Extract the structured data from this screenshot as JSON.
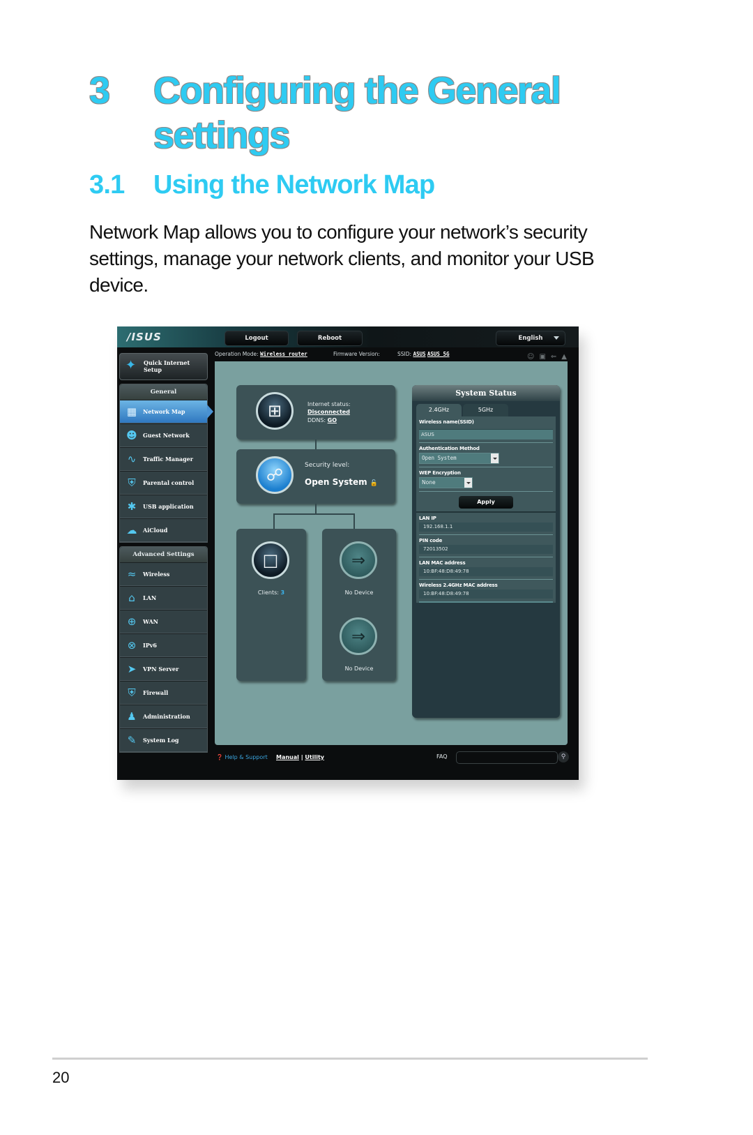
{
  "document": {
    "chapter_number": "3",
    "chapter_title": "Configuring the General settings",
    "section_number": "3.1",
    "section_title": "Using the Network Map",
    "paragraph": "Network Map allows you to configure your network’s security settings, manage your network clients, and monitor your USB device.",
    "page_number": "20"
  },
  "router_ui": {
    "logo": "/ISUS",
    "top_buttons": {
      "logout": "Logout",
      "reboot": "Reboot",
      "language": "English"
    },
    "op_bar": {
      "operation_mode_label": "Operation Mode:",
      "operation_mode_value": "Wireless router",
      "firmware_label": "Firmware Version:",
      "ssid_label": "SSID:",
      "ssid_24": "ASUS",
      "ssid_5": "ASUS_5G",
      "status_icons": [
        "clients-icon",
        "network-icon",
        "usb-icon",
        "printer-icon"
      ]
    },
    "quick_setup": {
      "label_line1": "Quick Internet",
      "label_line2": "Setup",
      "icon": "magic-wand-icon"
    },
    "general_menu": {
      "header": "General",
      "items": [
        {
          "label": "Network Map",
          "icon": "network-map-icon",
          "active": true
        },
        {
          "label": "Guest Network",
          "icon": "guest-network-icon"
        },
        {
          "label": "Traffic Manager",
          "icon": "traffic-manager-icon"
        },
        {
          "label": "Parental control",
          "icon": "parental-lock-icon"
        },
        {
          "label": "USB application",
          "icon": "puzzle-icon"
        },
        {
          "label": "AiCloud",
          "icon": "cloud-icon"
        }
      ]
    },
    "advanced_menu": {
      "header": "Advanced Settings",
      "items": [
        {
          "label": "Wireless",
          "icon": "wifi-icon"
        },
        {
          "label": "LAN",
          "icon": "home-icon"
        },
        {
          "label": "WAN",
          "icon": "globe-icon"
        },
        {
          "label": "IPv6",
          "icon": "ipv6-globe-icon"
        },
        {
          "label": "VPN Server",
          "icon": "vpn-icon"
        },
        {
          "label": "Firewall",
          "icon": "shield-icon"
        },
        {
          "label": "Administration",
          "icon": "admin-user-icon"
        },
        {
          "label": "System Log",
          "icon": "log-edit-icon"
        }
      ]
    },
    "network_map": {
      "internet_status_label": "Internet status:",
      "internet_status_value": "Disconnected",
      "ddns_label": "DDNS:",
      "ddns_link": "GO",
      "security_level_label": "Security level:",
      "security_level_value": "Open System",
      "clients_label": "Clients:",
      "clients_count": "3",
      "usb1_status": "No Device",
      "usb2_status": "No Device"
    },
    "system_status": {
      "title": "System Status",
      "tabs": [
        "2.4GHz",
        "5GHz"
      ],
      "active_tab": "2.4GHz",
      "ssid_label": "Wireless name(SSID)",
      "ssid_value": "ASUS",
      "auth_label": "Authentication Method",
      "auth_value": "Open System",
      "wep_label": "WEP Encryption",
      "wep_value": "None",
      "apply": "Apply",
      "lan_ip_label": "LAN IP",
      "lan_ip_value": "192.168.1.1",
      "pin_label": "PIN code",
      "pin_value": "72013502",
      "lan_mac_label": "LAN MAC address",
      "lan_mac_value": "10:BF:48:D8:49:78",
      "wl_mac_label": "Wireless 2.4GHz MAC address",
      "wl_mac_value": "10:BF:48:D8:49:78"
    },
    "footer": {
      "help": "Help & Support",
      "manual": "Manual",
      "separator": "|",
      "utility": "Utility",
      "faq": "FAQ",
      "faq_placeholder": ""
    }
  }
}
